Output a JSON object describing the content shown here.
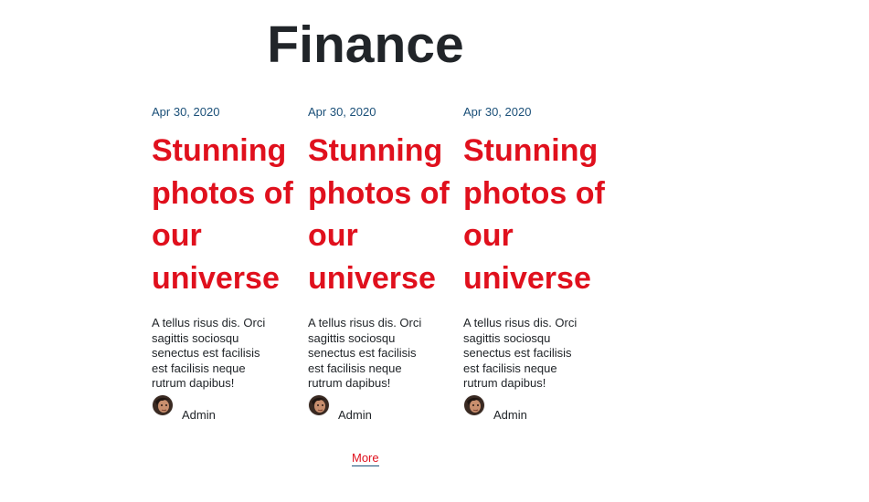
{
  "section": {
    "title": "Finance"
  },
  "posts": [
    {
      "date": "Apr 30, 2020",
      "title": "Stunning photos of our universe",
      "excerpt": "A tellus risus dis. Orci sagittis sociosqu senectus est facilisis est facilisis neque rutrum dapibus!",
      "author": "Admin"
    },
    {
      "date": "Apr 30, 2020",
      "title": "Stunning photos of our universe",
      "excerpt": "A tellus risus dis. Orci sagittis sociosqu senectus est facilisis est facilisis neque rutrum dapibus!",
      "author": "Admin"
    },
    {
      "date": "Apr 30, 2020",
      "title": "Stunning photos of our universe",
      "excerpt": "A tellus risus dis. Orci sagittis sociosqu senectus est facilisis est facilisis neque rutrum dapibus!",
      "author": "Admin"
    }
  ],
  "more": {
    "label": "More"
  },
  "colors": {
    "title_red": "#e0101d",
    "date_blue": "#1a4f78",
    "text_dark": "#212529"
  },
  "icons": {
    "avatar": "author-avatar-icon"
  }
}
